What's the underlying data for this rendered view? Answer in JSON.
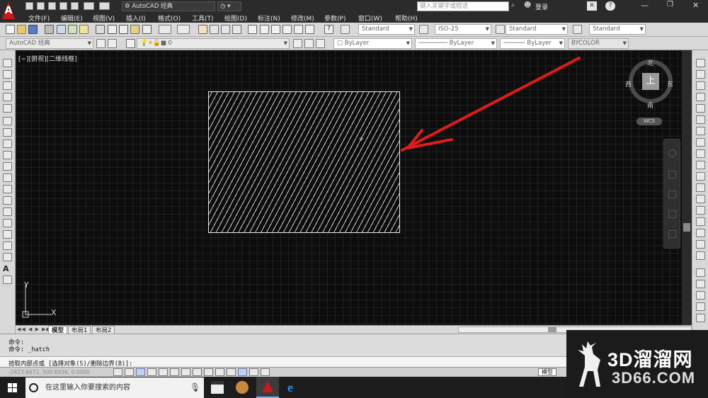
{
  "title_bar": {
    "workspace": "AutoCAD 经典",
    "search_placeholder": "键入关键字或短语",
    "login": "登录"
  },
  "menu": [
    "文件(F)",
    "编辑(E)",
    "视图(V)",
    "插入(I)",
    "格式(O)",
    "工具(T)",
    "绘图(D)",
    "标注(N)",
    "修改(M)",
    "参数(P)",
    "窗口(W)",
    "帮助(H)"
  ],
  "toolbar": {
    "text_style": "Standard",
    "dim_style": "ISO-25",
    "table_style": "Standard",
    "mleader_style": "Standard",
    "workspace_combo": "AutoCAD 经典",
    "layer_value": "0",
    "color": "ByLayer",
    "linetype": "ByLayer",
    "lineweight": "ByLayer",
    "plotstyle": "BYCOLOR"
  },
  "viewport": {
    "label": "[−][俯视][二维线框]",
    "compass": {
      "north": "北",
      "south": "南",
      "east": "东",
      "west": "西",
      "top": "上"
    },
    "wcs": "WCS",
    "ucs_x": "X",
    "ucs_y": "Y"
  },
  "tabs": {
    "model": "模型",
    "layout1": "布局1",
    "layout2": "布局2"
  },
  "command": {
    "line1": "命令:",
    "line2": "命令: _hatch",
    "prompt": "拾取内部点或 [选择对象(S)/删除边界(B)]:"
  },
  "status": {
    "coords": "-2423.6672, 500.6936, 0.0000",
    "model": "模型"
  },
  "taskbar": {
    "search_placeholder": "在这里输入你要搜索的内容"
  },
  "watermark": {
    "brand": "3D溜溜网",
    "domain": "3D66.COM"
  },
  "colors": {
    "accent_red": "#e01b1b",
    "canvas": "#0d0d0d"
  }
}
